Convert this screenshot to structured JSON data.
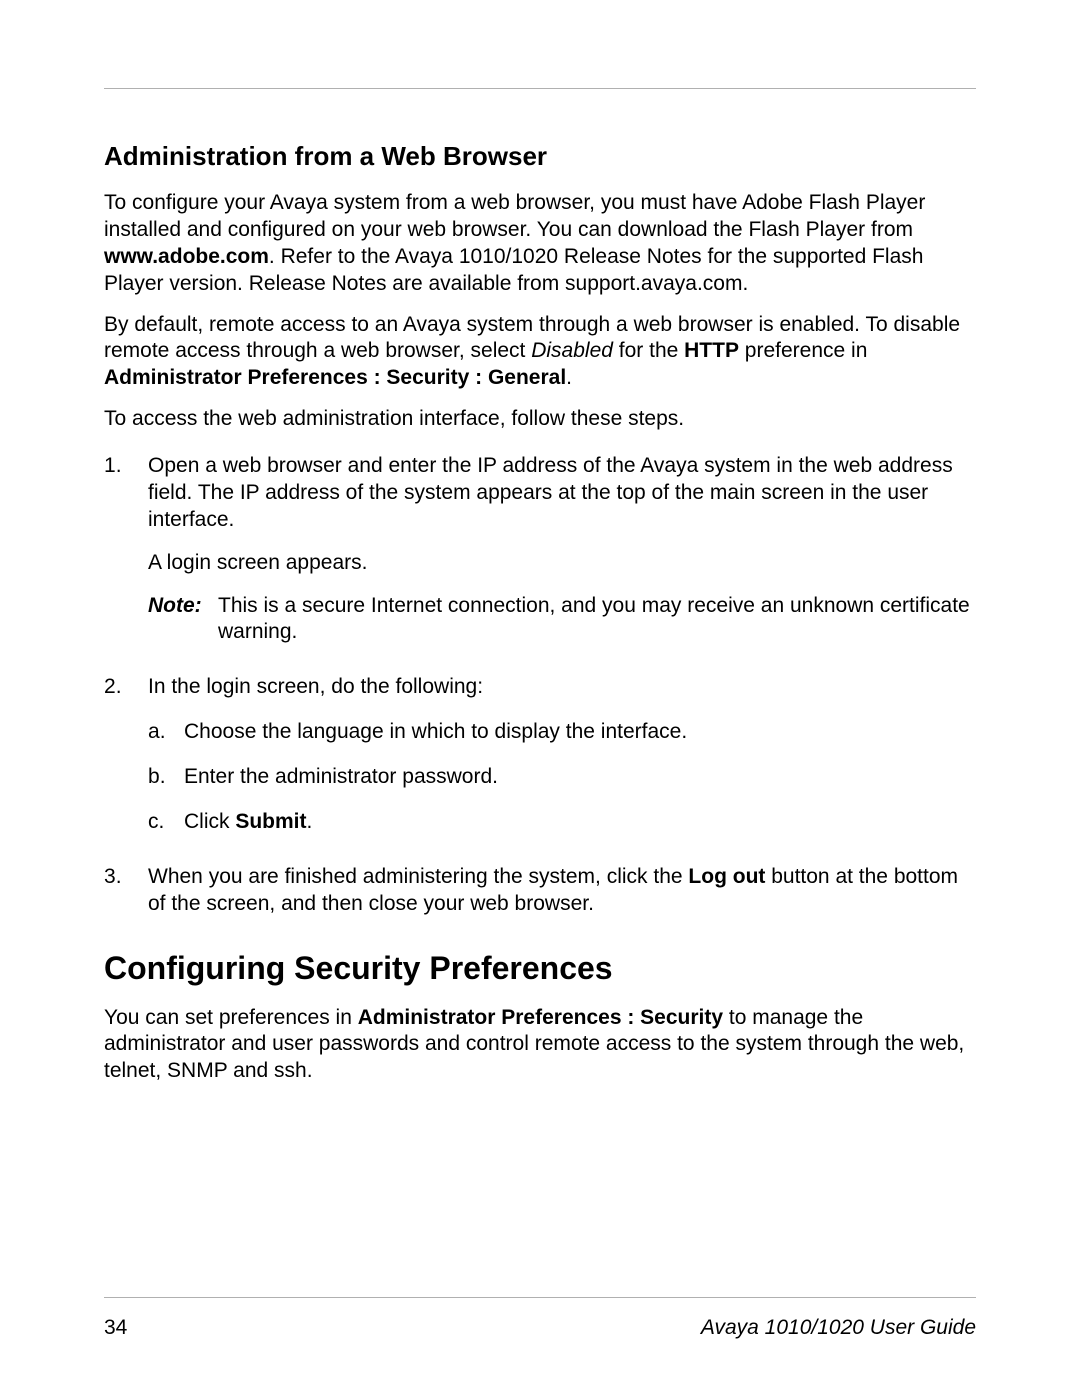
{
  "section1": {
    "title": "Administration from a Web Browser",
    "p1_a": "To configure your Avaya system from a web browser, you must have Adobe Flash Player installed and configured on your web browser. You can download the Flash Player from ",
    "p1_b": "www.adobe.com",
    "p1_c": ". Refer to the Avaya 1010/1020 Release Notes for the supported Flash Player version. Release Notes are available from support.avaya.com.",
    "p2_a": "By default, remote access to an Avaya system through a web browser is enabled. To disable remote access through a web browser, select ",
    "p2_b": "Disabled",
    "p2_c": " for the ",
    "p2_d": "HTTP",
    "p2_e": " preference in ",
    "p2_f": "Administrator Preferences : Security : General",
    "p2_g": ".",
    "p3": "To access the web administration interface, follow these steps.",
    "steps": {
      "s1": {
        "main": "Open a web browser and enter the IP address of the Avaya system in the web address field. The IP address of the system appears at the top of the main screen in the user interface.",
        "sub1": "A login screen appears.",
        "note_label": "Note:",
        "note_text": "This is a secure Internet connection, and you may receive an unknown certificate warning."
      },
      "s2": {
        "main": "In the login screen, do the following:",
        "a": "Choose the language in which to display the interface.",
        "b": "Enter the administrator password.",
        "c_pre": "Click ",
        "c_bold": "Submit",
        "c_post": "."
      },
      "s3": {
        "pre": "When you are finished administering the system, click the ",
        "bold": "Log out",
        "post": " button at the bottom of the screen, and then close your web browser."
      }
    }
  },
  "section2": {
    "title": "Configuring Security Preferences",
    "p1_a": "You can set preferences in ",
    "p1_b": "Administrator Preferences : Security",
    "p1_c": " to manage the administrator and user passwords and control remote access to the system through the web, telnet, SNMP and ssh."
  },
  "footer": {
    "page": "34",
    "guide": "Avaya 1010/1020 User Guide"
  }
}
